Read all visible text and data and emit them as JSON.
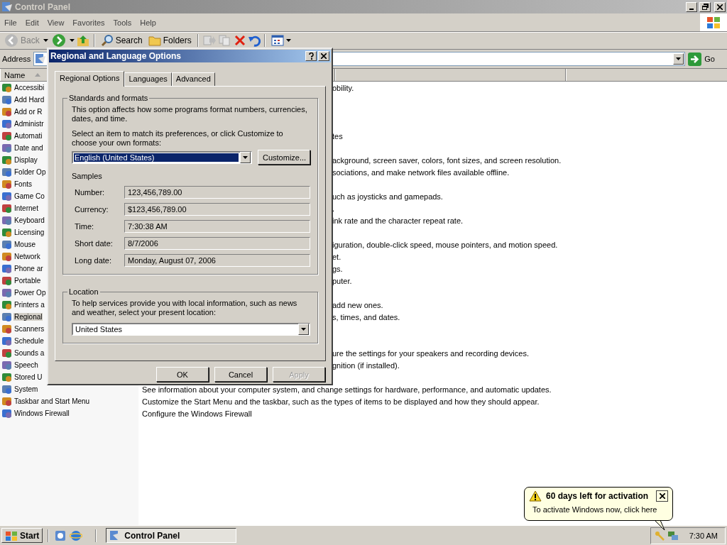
{
  "window": {
    "title": "Control Panel"
  },
  "menu": [
    {
      "label": "File"
    },
    {
      "label": "Edit"
    },
    {
      "label": "View"
    },
    {
      "label": "Favorites"
    },
    {
      "label": "Tools"
    },
    {
      "label": "Help"
    }
  ],
  "toolbar": {
    "back": "Back",
    "search": "Search",
    "folders": "Folders"
  },
  "address": {
    "label": "Address",
    "go": "Go"
  },
  "list": {
    "columns": [
      {
        "label": "Name"
      }
    ],
    "rows": [
      {
        "name": "Accessibi",
        "comment_fragment": "obility.",
        "selected": false
      },
      {
        "name": "Add Hard",
        "selected": false
      },
      {
        "name": "Add or R",
        "selected": false
      },
      {
        "name": "Administr",
        "selected": false
      },
      {
        "name": "Automati",
        "comment_fragment": "tes",
        "selected": false
      },
      {
        "name": "Date and",
        "selected": false
      },
      {
        "name": "Display",
        "comment_fragment": "ackground, screen saver, colors, font sizes, and screen resolution.",
        "selected": false
      },
      {
        "name": "Folder Op",
        "comment_fragment": "sociations, and make network files available offline.",
        "selected": false
      },
      {
        "name": "Fonts",
        "selected": false
      },
      {
        "name": "Game Co",
        "comment_fragment": "uch as joysticks and gamepads.",
        "selected": false
      },
      {
        "name": "Internet",
        "comment_fragment": ".",
        "selected": false
      },
      {
        "name": "Keyboard",
        "comment_fragment": "ink rate and the character repeat rate.",
        "selected": false
      },
      {
        "name": "Licensing",
        "selected": false
      },
      {
        "name": "Mouse",
        "comment_fragment": "iguration, double-click speed, mouse pointers, and motion speed.",
        "selected": false
      },
      {
        "name": "Network",
        "comment_fragment": "et.",
        "selected": false
      },
      {
        "name": "Phone ar",
        "comment_fragment": "gs.",
        "selected": false
      },
      {
        "name": "Portable",
        "comment_fragment": "puter.",
        "selected": false
      },
      {
        "name": "Power Op",
        "selected": false
      },
      {
        "name": "Printers a",
        "comment_fragment": "add new ones.",
        "selected": false
      },
      {
        "name": "Regional",
        "comment_fragment": "s, times, and dates.",
        "selected": true
      },
      {
        "name": "Scanners",
        "selected": false
      },
      {
        "name": "Schedule",
        "selected": false
      },
      {
        "name": "Sounds a",
        "comment_fragment": "ure the settings for your speakers and recording devices.",
        "selected": false
      },
      {
        "name": "Speech",
        "comment_fragment": "gnition (if installed).",
        "selected": false
      },
      {
        "name": "Stored U",
        "selected": false
      },
      {
        "name": "System",
        "comment": "See information about your computer system, and change settings for hardware, performance, and automatic updates.",
        "selected": false
      },
      {
        "name": "Taskbar and Start Menu",
        "comment": "Customize the Start Menu and the taskbar, such as the types of items to be displayed and how they should appear.",
        "selected": false
      },
      {
        "name": "Windows Firewall",
        "comment": "Configure the Windows Firewall",
        "selected": false
      }
    ]
  },
  "dialog": {
    "title": "Regional and Language Options",
    "tabs": [
      {
        "label": "Regional Options",
        "selected": true
      },
      {
        "label": "Languages",
        "selected": false
      },
      {
        "label": "Advanced",
        "selected": false
      }
    ],
    "standards": {
      "legend": "Standards and formats",
      "intro": "This option affects how some programs format numbers, currencies, dates, and time.",
      "prompt": "Select an item to match its preferences, or click Customize to choose your own formats:",
      "format": "English (United States)",
      "customize": "Customize...",
      "samples_label": "Samples",
      "samples": [
        {
          "label": "Number:",
          "value": "123,456,789.00"
        },
        {
          "label": "Currency:",
          "value": "$123,456,789.00"
        },
        {
          "label": "Time:",
          "value": "7:30:38 AM"
        },
        {
          "label": "Short date:",
          "value": "8/7/2006"
        },
        {
          "label": "Long date:",
          "value": "Monday, August 07, 2006"
        }
      ]
    },
    "location": {
      "legend": "Location",
      "text": "To help services provide you with local information, such as news and weather, select your present location:",
      "value": "United States"
    },
    "buttons": [
      {
        "label": "OK",
        "disabled": false
      },
      {
        "label": "Cancel",
        "disabled": false
      },
      {
        "label": "Apply",
        "disabled": true
      }
    ]
  },
  "balloon": {
    "title": "60 days left for activation",
    "text": "To activate Windows now, click here"
  },
  "taskbar": {
    "start": "Start",
    "tasks": [
      {
        "label": "Control Panel"
      }
    ],
    "clock": "7:30 AM"
  }
}
